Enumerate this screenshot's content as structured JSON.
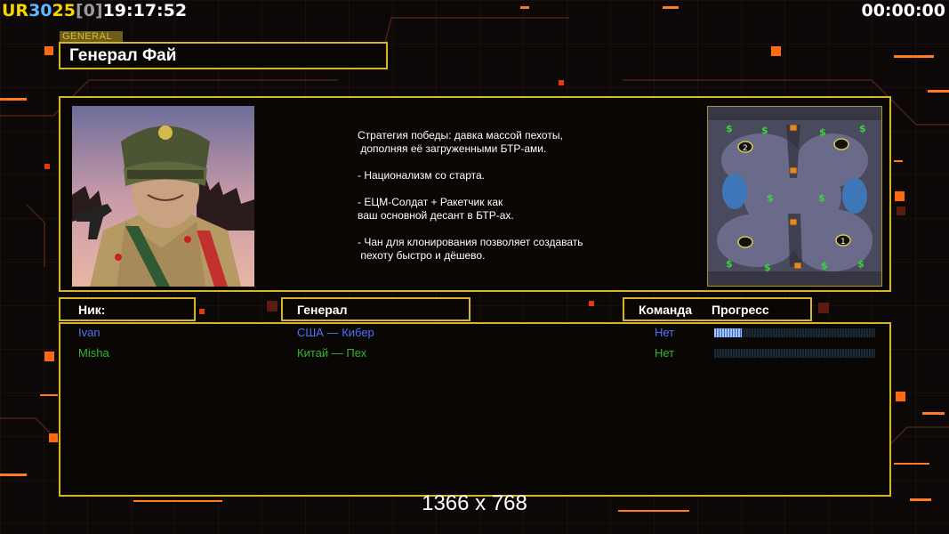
{
  "hud": {
    "ur_label": "UR",
    "fps": "30",
    "logic_fps": "25",
    "bracket_value": "[0]",
    "clock": "19:17:52",
    "game_timer": "00:00:00"
  },
  "general_tag": "GENERAL",
  "general_name": "Генерал Фай",
  "description": "Стратегия победы: давка массой пехоты,\n дополняя её загруженными БТР-ами.\n\n- Национализм со старта.\n\n- ЕЦМ-Солдат + Ракетчик как\nваш основной десант в БТР-ах.\n\n- Чан для клонирования позволяет создавать\n пехоту быстро и дёшево.",
  "headers": {
    "nick": "Ник:",
    "general": "Генерал",
    "team": "Команда",
    "progress": "Прогресс"
  },
  "players": [
    {
      "nick": "Ivan",
      "general": "США — Кибер",
      "team": "Нет",
      "progress": 0.17,
      "color": "#4a73ff"
    },
    {
      "nick": "Misha",
      "general": "Китай — Пех",
      "team": "Нет",
      "progress": 0.0,
      "color": "#34b52c"
    }
  ],
  "minimap": {
    "start_positions": [
      "2",
      "1"
    ]
  },
  "resolution": "1366 x 768",
  "colors": {
    "frame_gold": "#d7b52a",
    "player1": "#4a73ff",
    "player2": "#34b52c"
  }
}
